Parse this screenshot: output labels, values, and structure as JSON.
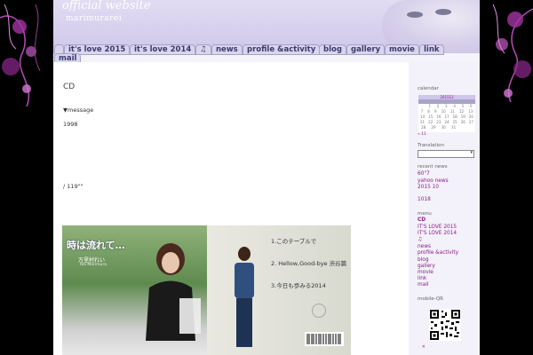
{
  "header": {
    "title": "official website",
    "subtitle": "marimurarei"
  },
  "nav": {
    "tabs": [
      {
        "label": "it's love 2015"
      },
      {
        "label": "it's love 2014"
      },
      {
        "label": "♫"
      },
      {
        "label": "news"
      },
      {
        "label": "profile &activity"
      },
      {
        "label": "blog"
      },
      {
        "label": "gallery"
      },
      {
        "label": "movie"
      },
      {
        "label": "link"
      },
      {
        "label": "mail"
      }
    ]
  },
  "main": {
    "title": "CD",
    "message_label": "▼message",
    "year": "1998",
    "note": "/ 119\"\""
  },
  "cd": {
    "front_title": "時は流れて…",
    "artist_jp": "万里村れい",
    "artist_en": "Rei Marimura",
    "tracks": [
      {
        "label": "1.このテーブルで"
      },
      {
        "label": "2. Hellow,Good-bye 渋谷篇"
      },
      {
        "label": "3.今日も歩みる2014"
      }
    ]
  },
  "sidebar": {
    "calendar_label": "calendar",
    "calendar_month": "201512",
    "translation_label": "Translation",
    "recent_news_label": "recent news",
    "recent_news": [
      {
        "label": "60\"7"
      },
      {
        "label": "yahoo news"
      },
      {
        "label": "2015 10"
      },
      {
        "label": "1018"
      }
    ],
    "menu_label": "menu",
    "menu": [
      {
        "label": "CD"
      },
      {
        "label": "IT'S LOVE 2015"
      },
      {
        "label": "IT'S LOVE 2014"
      },
      {
        "label": "♫"
      },
      {
        "label": "news"
      },
      {
        "label": "profile &activity"
      },
      {
        "label": "blog"
      },
      {
        "label": "gallery"
      },
      {
        "label": "movie"
      },
      {
        "label": "link"
      },
      {
        "label": "mail"
      }
    ],
    "mobile_label": "mobile-QR",
    "footer_mark": "«"
  }
}
